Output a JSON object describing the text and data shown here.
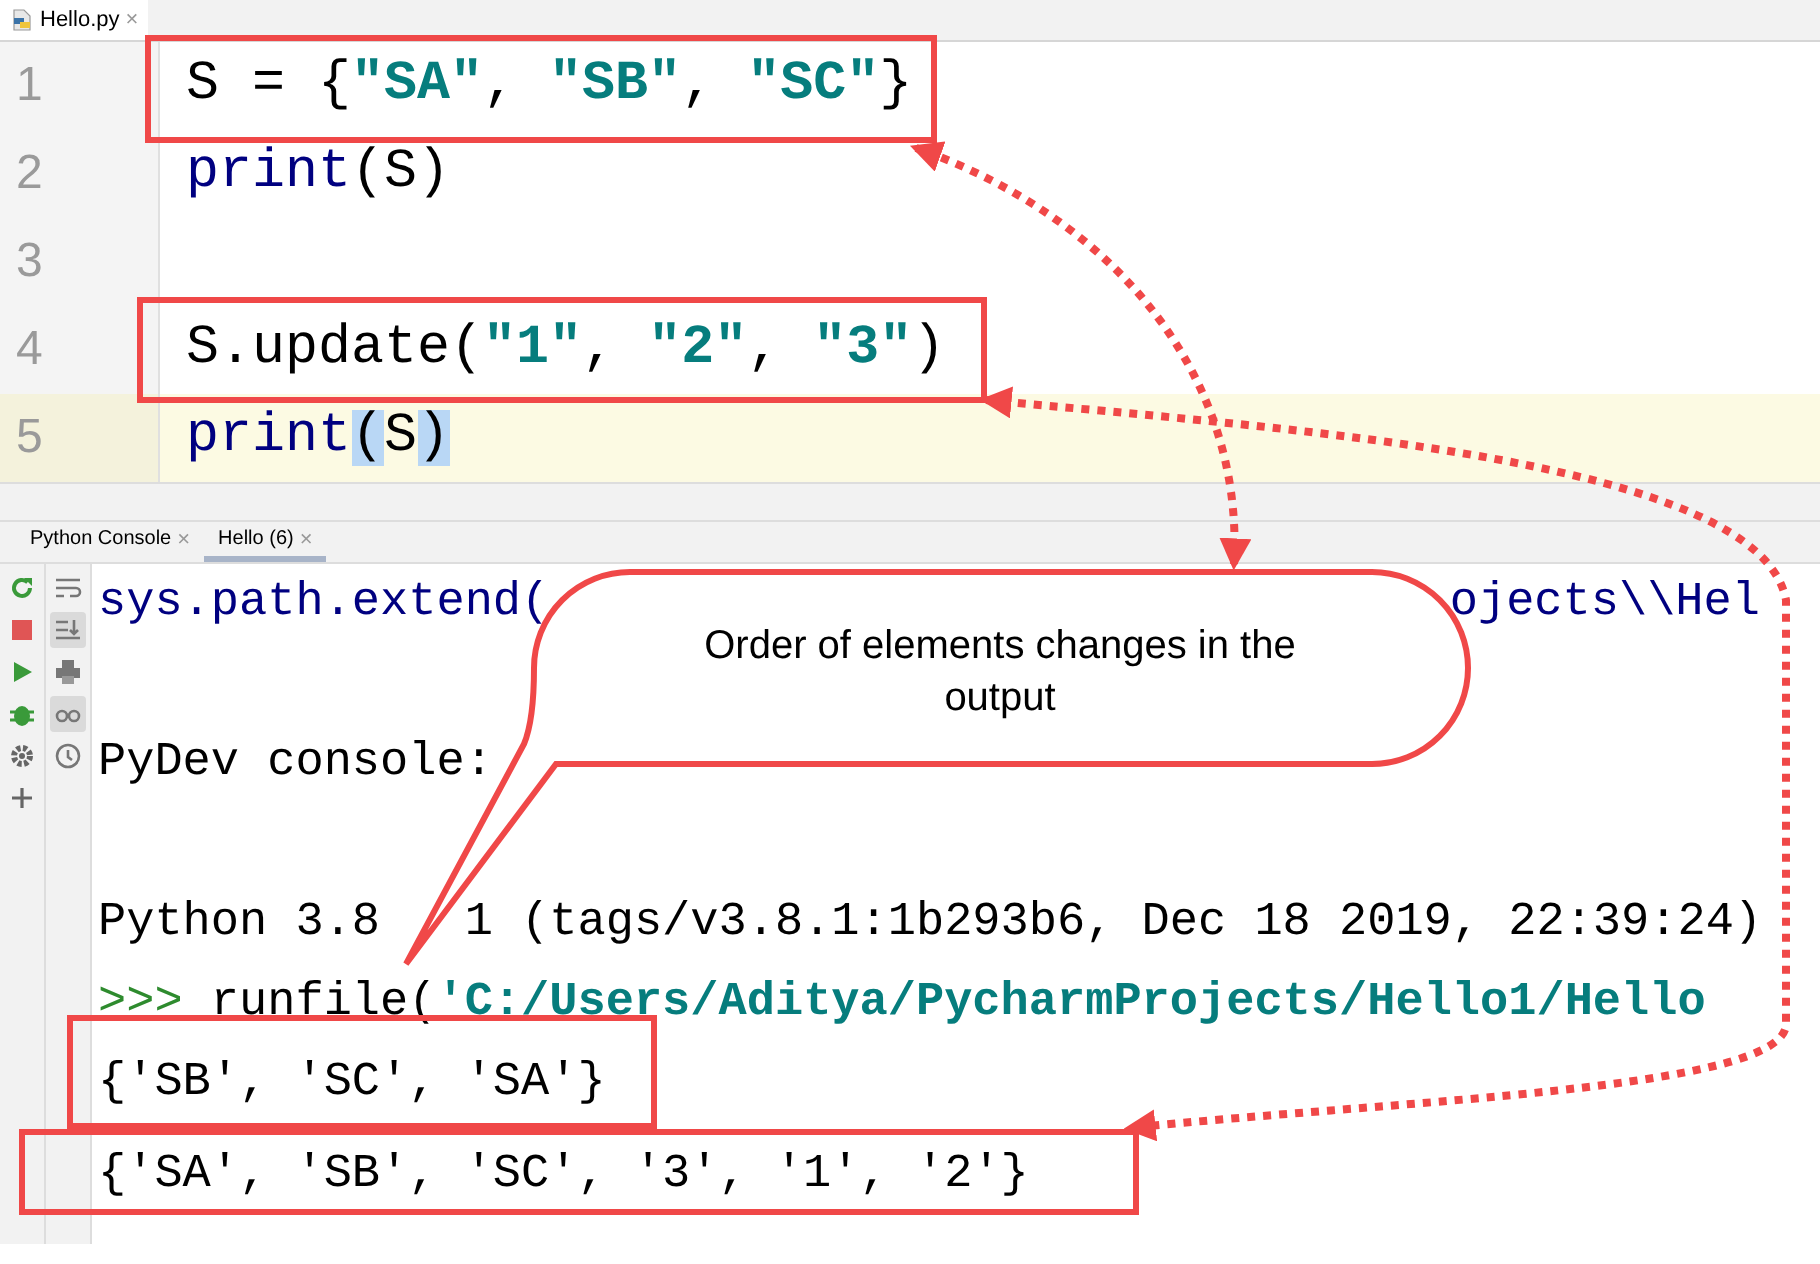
{
  "editor": {
    "tab": {
      "label": "Hello.py",
      "close": "×",
      "selected": true
    },
    "lines": [
      {
        "number": "1",
        "current": false,
        "tokens": [
          {
            "text": "S = {",
            "kind": "plain"
          },
          {
            "text": "\"SA\"",
            "kind": "string"
          },
          {
            "text": ", ",
            "kind": "plain"
          },
          {
            "text": "\"SB\"",
            "kind": "string"
          },
          {
            "text": ", ",
            "kind": "plain"
          },
          {
            "text": "\"SC\"",
            "kind": "string"
          },
          {
            "text": "}",
            "kind": "plain"
          }
        ]
      },
      {
        "number": "2",
        "current": false,
        "tokens": [
          {
            "text": "print",
            "kind": "builtin"
          },
          {
            "text": "(S)",
            "kind": "plain"
          }
        ]
      },
      {
        "number": "3",
        "current": false
      },
      {
        "number": "4",
        "current": false,
        "tokens": [
          {
            "text": "S.update(",
            "kind": "plain"
          },
          {
            "text": "\"1\"",
            "kind": "string"
          },
          {
            "text": ", ",
            "kind": "plain"
          },
          {
            "text": "\"2\"",
            "kind": "string"
          },
          {
            "text": ", ",
            "kind": "plain"
          },
          {
            "text": "\"3\"",
            "kind": "string"
          },
          {
            "text": ")",
            "kind": "plain"
          }
        ]
      },
      {
        "number": "5",
        "current": true,
        "tokens": [
          {
            "text": "print",
            "kind": "builtin"
          },
          {
            "text": "(",
            "kind": "plain",
            "matched": true
          },
          {
            "text": "S",
            "kind": "plain"
          },
          {
            "text": ")",
            "kind": "plain",
            "matched": true
          }
        ]
      }
    ]
  },
  "console": {
    "tabs": [
      {
        "label": "Python Console",
        "close": "×",
        "selected": false
      },
      {
        "label": "Hello (6)",
        "close": "×",
        "selected": true
      }
    ],
    "run_toolbar": [
      {
        "kind": "rerun"
      },
      {
        "kind": "stop"
      },
      {
        "kind": "run"
      },
      {
        "kind": "debug"
      },
      {
        "kind": "settings"
      },
      {
        "kind": "add"
      }
    ],
    "view_toolbar": [
      {
        "kind": "soft-wrap",
        "on": false
      },
      {
        "kind": "scroll-end",
        "on": true
      },
      {
        "kind": "print",
        "on": false
      },
      {
        "kind": "glasses",
        "on": true
      },
      {
        "kind": "history",
        "on": false
      }
    ],
    "lines": [
      {
        "fragments": [
          {
            "text": "sys.path.extend(",
            "kind": "code"
          },
          {
            "text": "ojects\\\\Hel",
            "kind": "code"
          }
        ]
      },
      {
        "fragments": [
          {
            "text": "PyDev console:",
            "kind": "plain"
          }
        ]
      },
      {
        "fragments": [
          {
            "text": "Python 3.8",
            "kind": "plain"
          },
          {
            "text": "1 (tags/v3.8.1:1b293b6, Dec 18 2019, 22:39:24)",
            "kind": "plain"
          }
        ]
      },
      {
        "fragments": [
          {
            "text": ">>>",
            "kind": "prompt"
          },
          {
            "text": " runfile(",
            "kind": "plain"
          },
          {
            "text": "'C:/Users/Aditya/PycharmProjects/Hello1/Hello",
            "kind": "string"
          }
        ]
      },
      {
        "fragments": [
          {
            "text": "{'SB', 'SC', 'SA'}",
            "kind": "plain"
          }
        ]
      },
      {
        "fragments": [
          {
            "text": "{'SA', 'SB', 'SC', '3', '1', '2'}",
            "kind": "plain"
          }
        ]
      }
    ]
  },
  "annotation": {
    "callout": "Order of elements changes in the output"
  }
}
